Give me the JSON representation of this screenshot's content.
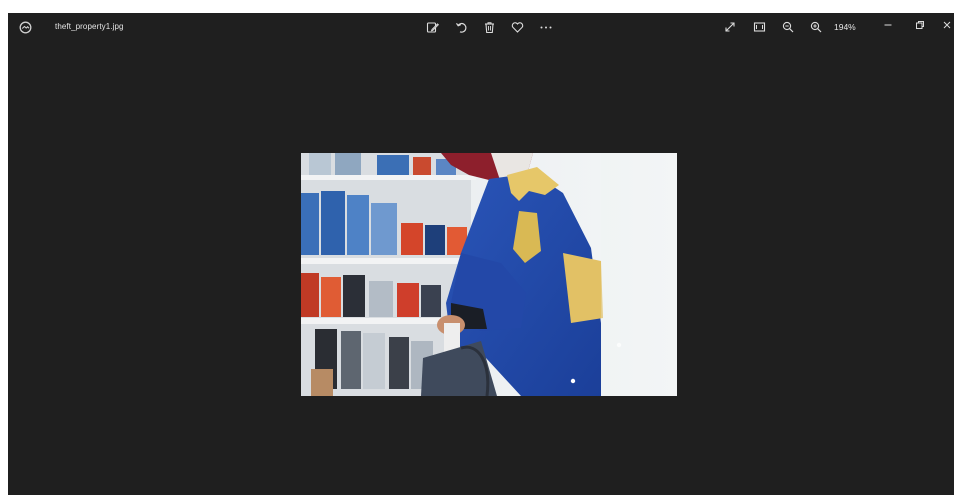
{
  "window": {
    "file_name": "theft_property1.jpg",
    "zoom_level": "194%"
  },
  "toolbar": {
    "icons": [
      "edit-image-icon",
      "rotate-icon",
      "delete-icon",
      "favorite-heart-icon",
      "more-options-icon"
    ]
  },
  "view_controls": {
    "icons": [
      "full-screen-icon",
      "fit-to-window-icon",
      "zoom-out-icon",
      "zoom-in-icon"
    ]
  },
  "window_controls": {
    "icons": [
      "minimize-icon",
      "restore-icon",
      "close-icon"
    ]
  },
  "colors": {
    "background": "#1f1f1f",
    "text": "#e6e6e6",
    "icon": "#dcdcdc"
  }
}
